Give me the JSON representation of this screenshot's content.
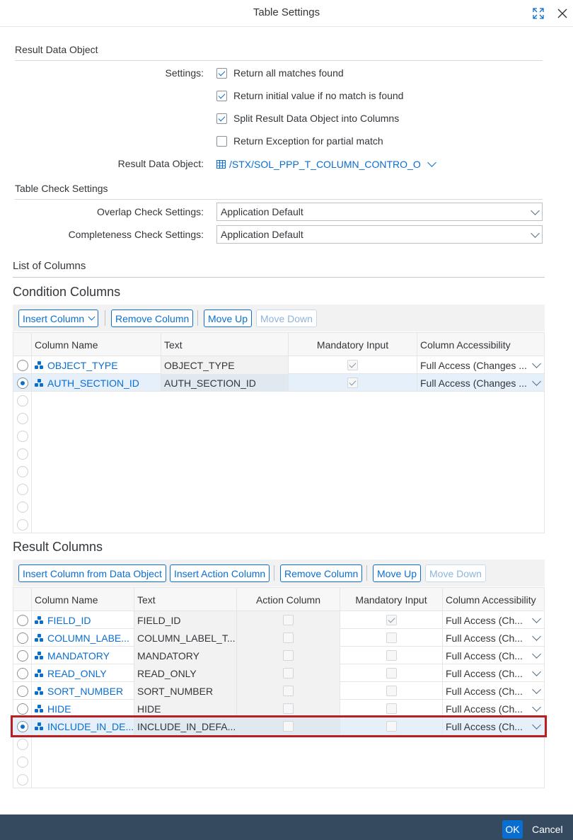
{
  "dialog": {
    "title": "Table Settings",
    "ok_label": "OK",
    "cancel_label": "Cancel"
  },
  "result_data_object_section": {
    "title": "Result Data Object",
    "settings_label": "Settings:",
    "options": [
      {
        "label": "Return all matches found",
        "checked": true
      },
      {
        "label": "Return initial value if no match is found",
        "checked": true
      },
      {
        "label": "Split Result Data Object into Columns",
        "checked": true
      },
      {
        "label": "Return Exception for partial match",
        "checked": false
      }
    ],
    "rdo_label": "Result Data Object:",
    "rdo_value": "/STX/SOL_PPP_T_COLUMN_CONTRO_O"
  },
  "table_check_section": {
    "title": "Table Check Settings",
    "overlap_label": "Overlap Check Settings:",
    "overlap_value": "Application Default",
    "completeness_label": "Completeness Check Settings:",
    "completeness_value": "Application Default"
  },
  "list_of_columns_title": "List of Columns",
  "condition_columns": {
    "title": "Condition Columns",
    "toolbar": {
      "insert": "Insert Column",
      "remove": "Remove Column",
      "move_up": "Move Up",
      "move_down": "Move Down"
    },
    "headers": [
      "Column Name",
      "Text",
      "Mandatory Input",
      "Column Accessibility"
    ],
    "rows": [
      {
        "name": "OBJECT_TYPE",
        "text": "OBJECT_TYPE",
        "mandatory": true,
        "access": "Full Access (Changes ...",
        "selected": false
      },
      {
        "name": "AUTH_SECTION_ID",
        "text": "AUTH_SECTION_ID",
        "mandatory": true,
        "access": "Full Access (Changes ...",
        "selected": true
      }
    ]
  },
  "result_columns": {
    "title": "Result Columns",
    "toolbar": {
      "insert_from_do": "Insert Column from Data Object",
      "insert_action": "Insert Action Column",
      "remove": "Remove Column",
      "move_up": "Move Up",
      "move_down": "Move Down"
    },
    "headers": [
      "Column Name",
      "Text",
      "Action Column",
      "Mandatory Input",
      "Column Accessibility"
    ],
    "rows": [
      {
        "name": "FIELD_ID",
        "text": "FIELD_ID",
        "mandatory": true,
        "access": "Full Access (Ch...",
        "selected": false
      },
      {
        "name": "COLUMN_LABE...",
        "text": "COLUMN_LABEL_T...",
        "mandatory": false,
        "access": "Full Access (Ch...",
        "selected": false
      },
      {
        "name": "MANDATORY",
        "text": "MANDATORY",
        "mandatory": false,
        "access": "Full Access (Ch...",
        "selected": false
      },
      {
        "name": "READ_ONLY",
        "text": "READ_ONLY",
        "mandatory": false,
        "access": "Full Access (Ch...",
        "selected": false
      },
      {
        "name": "SORT_NUMBER",
        "text": "SORT_NUMBER",
        "mandatory": false,
        "access": "Full Access (Ch...",
        "selected": false
      },
      {
        "name": "HIDE",
        "text": "HIDE",
        "mandatory": false,
        "access": "Full Access (Ch...",
        "selected": false
      },
      {
        "name": "INCLUDE_IN_DE...",
        "text": "INCLUDE_IN_DEFA...",
        "mandatory": false,
        "access": "Full Access (Ch...",
        "selected": true
      }
    ]
  }
}
